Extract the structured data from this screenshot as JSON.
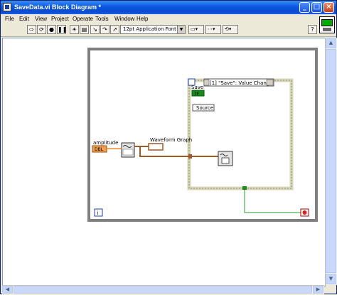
{
  "window": {
    "title": "SaveData.vi Block Diagram *",
    "buttons": [
      "_",
      "□",
      "×"
    ]
  },
  "menu": [
    "File",
    "Edit",
    "View",
    "Project",
    "Operate",
    "Tools",
    "Window",
    "Help"
  ],
  "toolbar": {
    "font": "12pt Application Font"
  },
  "diagram": {
    "amplitude_label": "amplitude",
    "amplitude_terminal": "DBL",
    "waveform_graph_label": "Waveform Graph",
    "event_case_selector": "[1] \"Save\": Value Change",
    "save_label": "Save",
    "save_terminal": "TF",
    "source_label": "Source",
    "iteration_icon": "i",
    "colors": {
      "loop_border": "#7f7f7f",
      "orange_wire": "#f08c28",
      "brown_wire": "#9a5a2a",
      "green_wire": "#2a9a2a",
      "event_border": "#d8d6b8"
    }
  }
}
